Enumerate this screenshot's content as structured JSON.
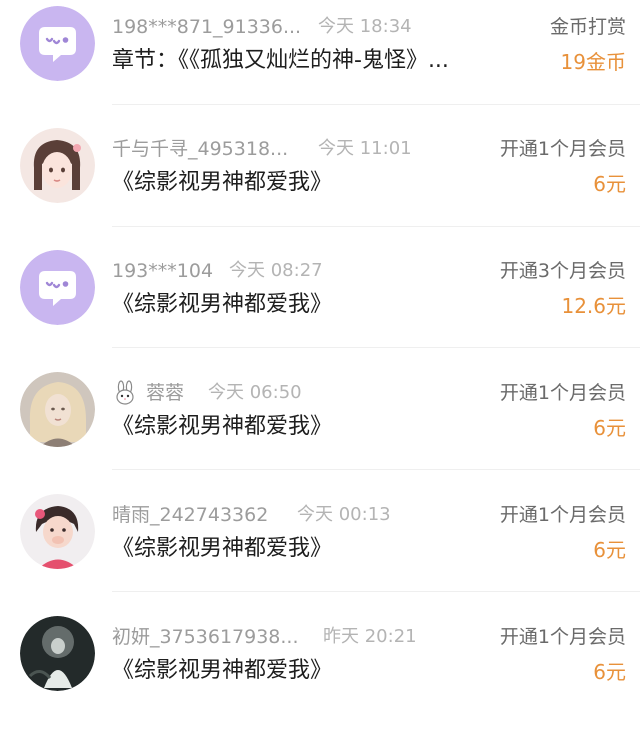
{
  "records": [
    {
      "name": "198***871_91336...",
      "time": "今天 18:34",
      "content": "章节：《《孤独又灿烂的神-鬼怪》...",
      "action": "金币打赏",
      "amount": "19金币",
      "avatar": "chat-bubble-icon"
    },
    {
      "name": "千与千寻_495318...",
      "time": "今天 11:01",
      "content": "《综影视男神都爱我》",
      "action": "开通1个月会员",
      "amount": "6元",
      "avatar": "user-avatar-photo"
    },
    {
      "name": "193***104",
      "time": "今天 08:27",
      "content": "《综影视男神都爱我》",
      "action": "开通3个月会员",
      "amount": "12.6元",
      "avatar": "chat-bubble-icon"
    },
    {
      "name": "蓉蓉",
      "time": "今天 06:50",
      "content": "《综影视男神都爱我》",
      "action": "开通1个月会员",
      "amount": "6元",
      "avatar": "user-avatar-photo",
      "badge": "bunny-icon"
    },
    {
      "name": "晴雨_242743362",
      "time": "今天 00:13",
      "content": "《综影视男神都爱我》",
      "action": "开通1个月会员",
      "amount": "6元",
      "avatar": "user-avatar-photo"
    },
    {
      "name": "初妍_3753617938...",
      "time": "昨天 20:21",
      "content": "《综影视男神都爱我》",
      "action": "开通1个月会员",
      "amount": "6元",
      "avatar": "user-avatar-photo"
    }
  ],
  "colors": {
    "amount": "#e8913a",
    "name": "#9c9c9c",
    "time": "#b4b4b4",
    "content": "#1e1e1e",
    "action": "#6a6a6a",
    "bubble_bg": "#c9b6f0"
  }
}
